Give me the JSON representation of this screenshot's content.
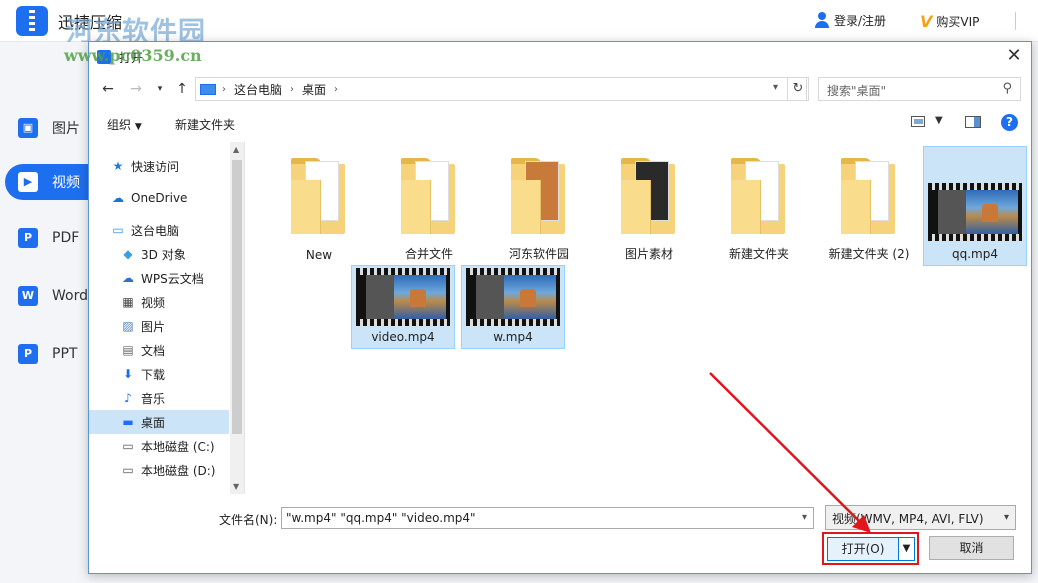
{
  "app": {
    "title": "迅捷压缩",
    "watermark_cn": "河东软件园",
    "watermark_url": "www.pc0359.cn",
    "login": "登录/注册",
    "vip": "购买VIP",
    "sidebar": [
      {
        "label": "图片",
        "icon": "image-icon"
      },
      {
        "label": "视频",
        "icon": "video-icon"
      },
      {
        "label": "PDF",
        "icon": "pdf-icon"
      },
      {
        "label": "Word",
        "icon": "word-icon"
      },
      {
        "label": "PPT",
        "icon": "ppt-icon"
      }
    ]
  },
  "dialog": {
    "title": "打开",
    "breadcrumb": [
      "这台电脑",
      "桌面"
    ],
    "search_placeholder": "搜索\"桌面\"",
    "organize": "组织",
    "new_folder": "新建文件夹",
    "nav": [
      {
        "label": "快速访问",
        "icon": "star-icon"
      },
      {
        "label": "OneDrive",
        "icon": "cloud-icon"
      },
      {
        "label": "这台电脑",
        "icon": "computer-icon"
      },
      {
        "label": "3D 对象",
        "icon": "cube-icon"
      },
      {
        "label": "WPS云文档",
        "icon": "cloud-doc-icon"
      },
      {
        "label": "视频",
        "icon": "film-icon"
      },
      {
        "label": "图片",
        "icon": "picture-icon"
      },
      {
        "label": "文档",
        "icon": "document-icon"
      },
      {
        "label": "下载",
        "icon": "download-icon"
      },
      {
        "label": "音乐",
        "icon": "music-icon"
      },
      {
        "label": "桌面",
        "icon": "desktop-icon"
      },
      {
        "label": "本地磁盘 (C:)",
        "icon": "drive-icon"
      },
      {
        "label": "本地磁盘 (D:)",
        "icon": "drive-icon"
      }
    ],
    "files": [
      {
        "name": "New",
        "kind": "folder"
      },
      {
        "name": "合并文件",
        "kind": "folder"
      },
      {
        "name": "河东软件园",
        "kind": "folder"
      },
      {
        "name": "图片素材",
        "kind": "folder"
      },
      {
        "name": "新建文件夹",
        "kind": "folder"
      },
      {
        "name": "新建文件夹 (2)",
        "kind": "folder"
      },
      {
        "name": "qq.mp4",
        "kind": "video",
        "selected": true
      },
      {
        "name": "video.mp4",
        "kind": "video",
        "selected": true
      },
      {
        "name": "w.mp4",
        "kind": "video",
        "selected": true
      }
    ],
    "filename_label": "文件名(N):",
    "filename_value": "\"w.mp4\" \"qq.mp4\" \"video.mp4\"",
    "filetype": "视频(WMV, MP4, AVI, FLV)",
    "open_button": "打开(O)",
    "cancel_button": "取消",
    "highlight_color": "#e0161c"
  }
}
